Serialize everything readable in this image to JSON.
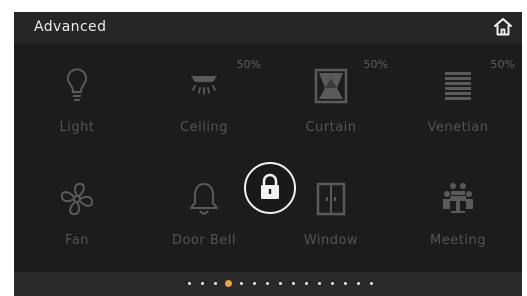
{
  "header": {
    "title": "Advanced"
  },
  "tiles": [
    {
      "label": "Light",
      "percent": ""
    },
    {
      "label": "Ceiling",
      "percent": "50%"
    },
    {
      "label": "Curtain",
      "percent": "50%"
    },
    {
      "label": "Venetian",
      "percent": "50%"
    },
    {
      "label": "Fan",
      "percent": ""
    },
    {
      "label": "Door Bell",
      "percent": ""
    },
    {
      "label": "Window",
      "percent": ""
    },
    {
      "label": "Meeting",
      "percent": ""
    }
  ],
  "icons": {
    "home": "home-icon",
    "lock": "lock-icon",
    "tiles": [
      "light-bulb-icon",
      "ceiling-fan-icon",
      "curtain-icon",
      "venetian-blind-icon",
      "fan-icon",
      "door-bell-icon",
      "window-icon",
      "meeting-icon"
    ]
  },
  "pagination": {
    "total": 15,
    "active": 4
  },
  "colors": {
    "accent": "#e9a04d",
    "background": "#1c1c1c",
    "header": "#262626",
    "text_muted": "#555555"
  }
}
